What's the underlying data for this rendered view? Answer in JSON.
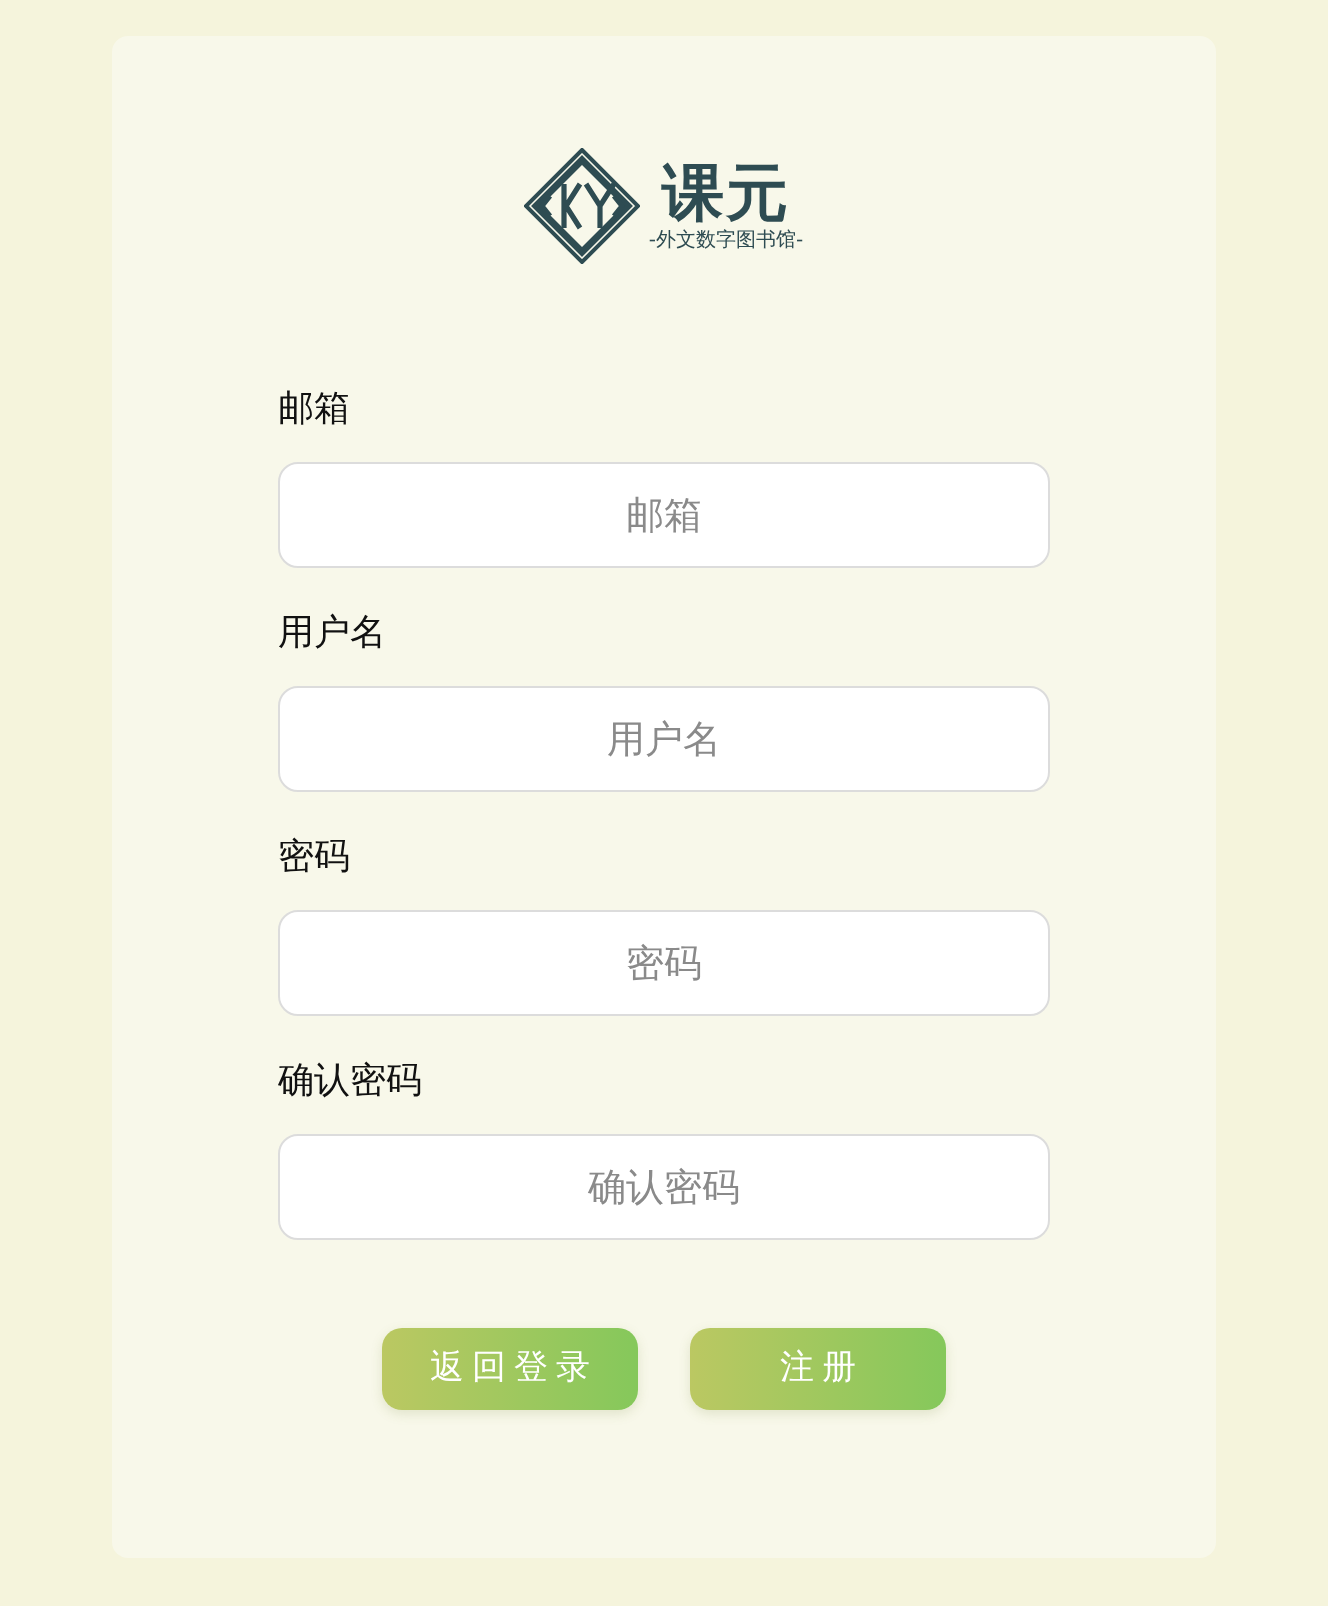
{
  "logo": {
    "brand": "课元",
    "tagline": "-外文数字图书馆-"
  },
  "fields": [
    {
      "label": "邮箱",
      "placeholder": "邮箱"
    },
    {
      "label": "用户名",
      "placeholder": "用户名"
    },
    {
      "label": "密码",
      "placeholder": "密码"
    },
    {
      "label": "确认密码",
      "placeholder": "确认密码"
    }
  ],
  "buttons": [
    {
      "label": "返回登录"
    },
    {
      "label": "注册"
    }
  ]
}
